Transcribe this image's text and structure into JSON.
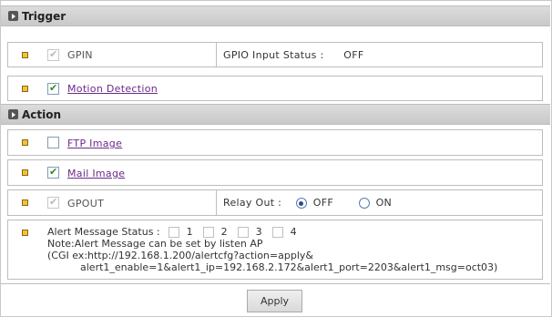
{
  "trigger": {
    "header": "Trigger",
    "gpin": {
      "label": "GPIN",
      "checked": true,
      "disabled": true
    },
    "gpio_status_label": "GPIO Input Status :",
    "gpio_status_value": "OFF",
    "motion": {
      "label": "Motion Detection",
      "checked": true
    }
  },
  "action": {
    "header": "Action",
    "ftp": {
      "label": "FTP Image",
      "checked": false
    },
    "mail": {
      "label": "Mail Image",
      "checked": true
    },
    "gpout": {
      "label": "GPOUT",
      "checked": true,
      "disabled": true
    },
    "relay": {
      "label": "Relay Out :",
      "options": [
        "OFF",
        "ON"
      ],
      "selected": "OFF"
    },
    "alert": {
      "label": "Alert Message Status :",
      "options": [
        "1",
        "2",
        "3",
        "4"
      ],
      "note_line1": "Note:Alert Message can be set by listen AP",
      "note_line2": "(CGI ex:http://192.168.1.200/alertcfg?action=apply&",
      "note_line3": "alert1_enable=1&alert1_ip=192.168.2.172&alert1_port=2203&alert1_msg=oct03)"
    }
  },
  "apply_label": "Apply",
  "colors": {
    "bullet": "#f0c23a",
    "link": "#6a2a8a",
    "header_bg": "#cfcfcf"
  }
}
